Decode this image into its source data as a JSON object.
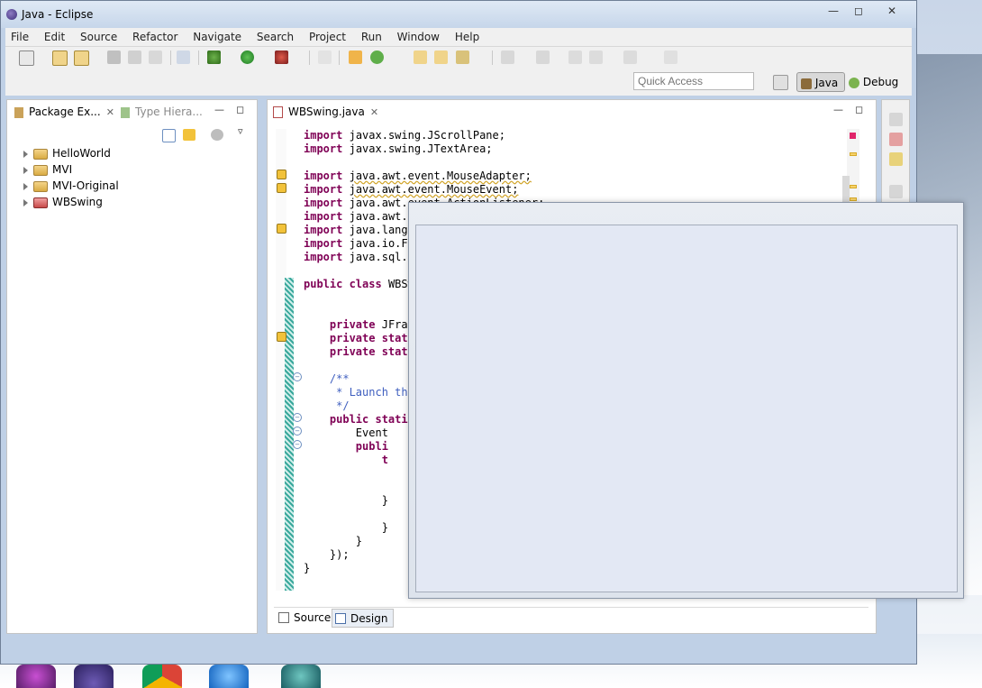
{
  "window": {
    "title": "Java - Eclipse"
  },
  "menu": [
    "File",
    "Edit",
    "Source",
    "Refactor",
    "Navigate",
    "Search",
    "Project",
    "Run",
    "Window",
    "Help"
  ],
  "quick_access": {
    "placeholder": "Quick Access"
  },
  "perspectives": {
    "java": "Java",
    "debug": "Debug"
  },
  "package_explorer": {
    "tab_label": "Package Ex...",
    "type_hierarchy_label": "Type Hiera...",
    "projects": [
      "HelloWorld",
      "MVI",
      "MVI-Original",
      "WBSwing"
    ]
  },
  "editor": {
    "tab_label": "WBSwing.java",
    "code": [
      "import javax.swing.JScrollPane;",
      "import javax.swing.JTextArea;",
      "",
      "import java.awt.event.MouseAdapter;",
      "import java.awt.event.MouseEvent;",
      "import java.awt.event.ActionListener;",
      "import java.awt.e",
      "import java.lang.",
      "import java.io.Fi",
      "import java.sql.*",
      "",
      "public class WBSw",
      "",
      "",
      "    private JFram",
      "    private stati",
      "    private stati",
      "",
      "    /**",
      "     * Launch the",
      "     */",
      "    public static",
      "        Event",
      "        publi",
      "            t",
      "",
      "",
      "            }",
      "",
      "            }",
      "        }",
      "    });",
      "}"
    ],
    "bottom_tabs": {
      "source": "Source",
      "design": "Design"
    }
  }
}
